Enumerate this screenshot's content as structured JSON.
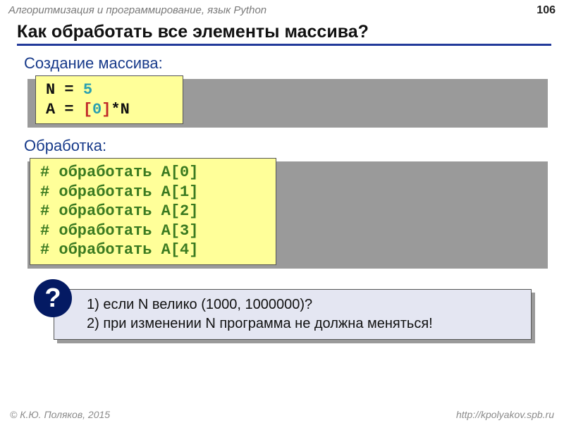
{
  "header": {
    "course": "Алгоритмизация и программирование, язык Python",
    "page": "106"
  },
  "title": "Как обработать все элементы массива?",
  "section1_label": "Создание массива:",
  "code1": {
    "l1a": "N = ",
    "l1b": "5",
    "l2a": "A = ",
    "l2b": "[",
    "l2c": "0",
    "l2d": "]",
    "l2e": "*N"
  },
  "section2_label": "Обработка:",
  "code2": {
    "l1": "# обработать A[0]",
    "l2": "# обработать A[1]",
    "l3": "# обработать A[2]",
    "l4": "# обработать A[3]",
    "l5": "# обработать A[4]"
  },
  "question": {
    "badge": "?",
    "line1": "1) если N велико (1000, 1000000)?",
    "line2": "2) при изменении N программа не должна меняться!"
  },
  "footer": {
    "left": "© К.Ю. Поляков, 2015",
    "right": "http://kpolyakov.spb.ru"
  }
}
